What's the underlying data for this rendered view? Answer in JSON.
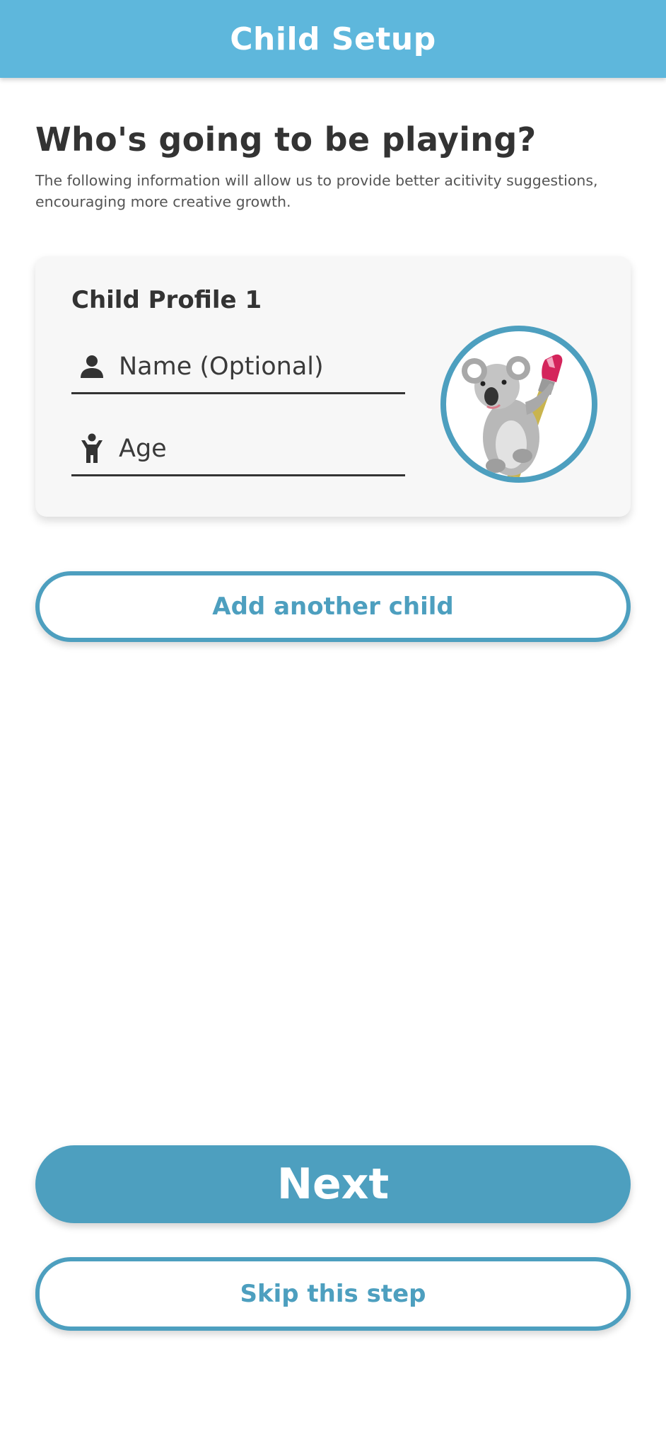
{
  "app_bar": {
    "title": "Child Setup",
    "background_color": "#5eb7dc"
  },
  "intro": {
    "heading": "Who's going to be playing?",
    "subtitle": "The following information will allow us to provide better acitivity suggestions, encouraging more creative growth."
  },
  "profile_card": {
    "title": "Child Profile 1",
    "name_field": {
      "icon": "person-icon",
      "value": "",
      "placeholder": "Name (Optional)"
    },
    "age_field": {
      "icon": "child-icon",
      "value": "",
      "placeholder": "Age"
    },
    "avatar": {
      "icon": "koala-painter-avatar",
      "ring_color": "#4d9fbf"
    }
  },
  "buttons": {
    "add_child": "Add another child",
    "next": "Next",
    "skip": "Skip this step"
  },
  "colors": {
    "accent": "#4d9fbf",
    "text_dark": "#333333",
    "text_muted": "#555555",
    "card_background": "#f7f7f7"
  }
}
